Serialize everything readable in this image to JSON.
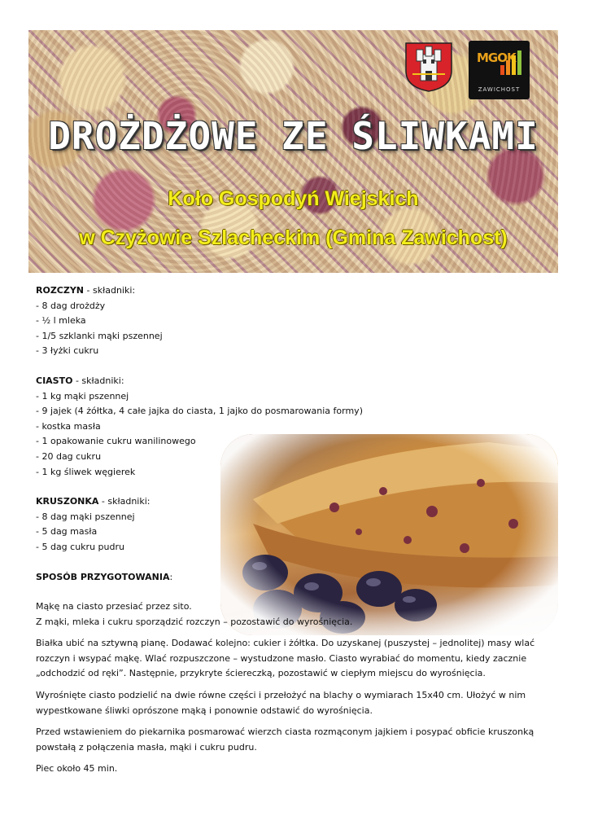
{
  "header": {
    "title": "DROŻDŻOWE ZE ŚLIWKAMI",
    "subtitle_line1": "Koło Gospodyń Wiejskich",
    "subtitle_line2": "w Czyżowie Szlacheckim (Gmina Zawichost)",
    "logo_letters": "MGOK",
    "logo_caption": "ZAWICHOST"
  },
  "rozczyn": {
    "heading": "ROZCZYN",
    "suffix": " - składniki:",
    "items": [
      "- 8 dag drożdży",
      "- ½ l mleka",
      "- 1/5 szklanki mąki pszennej",
      "- 3 łyżki cukru"
    ]
  },
  "ciasto": {
    "heading": "CIASTO",
    "suffix": " - składniki:",
    "items": [
      "- 1 kg mąki pszennej",
      "- 9 jajek (4 żółtka, 4 całe jajka do ciasta, 1 jajko do posmarowania formy)",
      "- kostka masła",
      "- 1 opakowanie cukru wanilinowego",
      "- 20 dag cukru",
      "- 1 kg śliwek węgierek"
    ]
  },
  "kruszonka": {
    "heading": "KRUSZONKA",
    "suffix": " - składniki:",
    "items": [
      "- 8 dag mąki pszennej",
      "- 5 dag masła",
      "- 5 dag cukru pudru"
    ]
  },
  "method": {
    "heading": "SPOSÓB PRZYGOTOWANIA",
    "suffix": ":",
    "p1_line1": "Mąkę na ciasto przesiać przez sito.",
    "p1_line2": "Z mąki, mleka i cukru sporządzić rozczyn – pozostawić do wyrośnięcia.",
    "p2_line1": "Białka ubić na sztywną pianę. Dodawać kolejno: cukier i żółtka. Do uzyskanej (puszystej – jednolitej) masy wlać",
    "p2_line2": "rozczyn i wsypać mąkę. Wlać rozpuszczone – wystudzone masło. Ciasto wyrabiać do momentu, kiedy zacznie",
    "p2_line3": "„odchodzić od ręki”. Następnie, przykryte ściereczką, pozostawić w ciepłym miejscu do wyrośnięcia.",
    "p3_line1": "Wyrośnięte ciasto podzielić na dwie równe części i przełożyć na blachy o wymiarach 15x40 cm. Ułożyć w nim",
    "p3_line2": "wypestkowane śliwki oprószone mąką i ponownie odstawić do wyrośnięcia.",
    "p4_line1": "Przed wstawieniem do piekarnika posmarować wierzch ciasta rozmąconym jajkiem i posypać obficie kruszonką",
    "p4_line2": "powstałą z połączenia masła, mąki i cukru pudru.",
    "p5": "Piec około 45 min."
  },
  "colors": {
    "subtitle": "#f3ee1a",
    "plum": "#2a2440",
    "logo_orange": "#e9a11a"
  }
}
